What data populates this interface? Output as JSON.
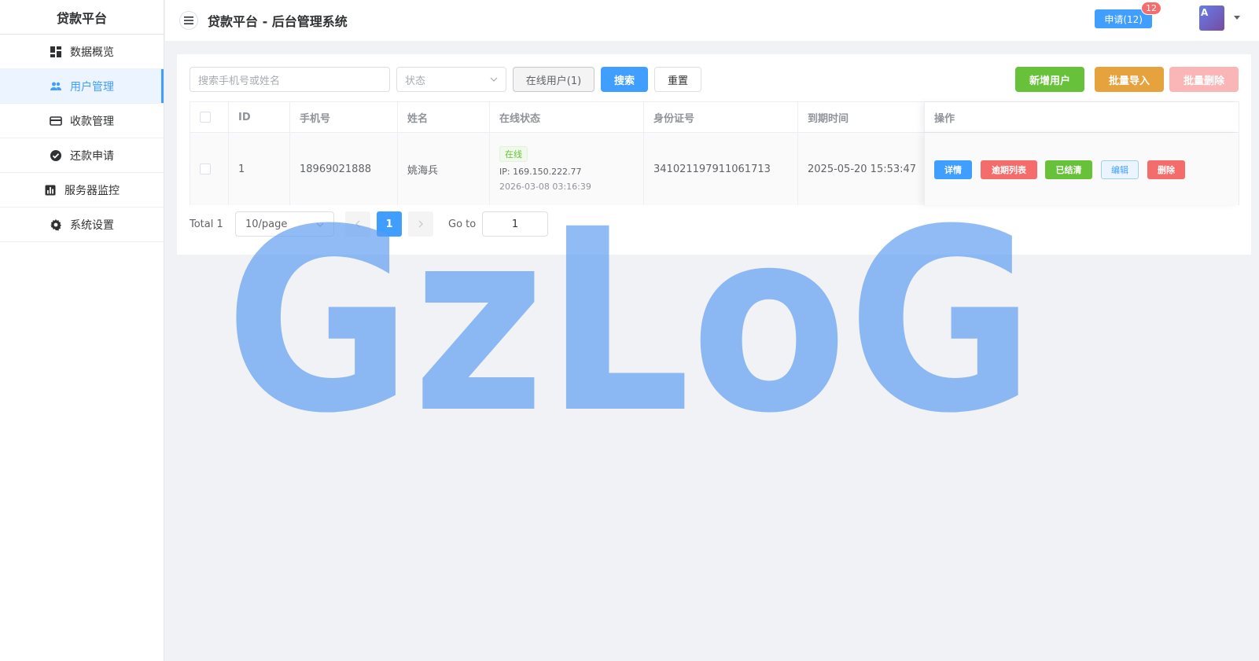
{
  "sidebar": {
    "brand": "贷款平台",
    "items": [
      {
        "label": "数据概览",
        "icon": "dashboard-icon"
      },
      {
        "label": "用户管理",
        "icon": "users-icon",
        "active": true
      },
      {
        "label": "收款管理",
        "icon": "credit-card-icon"
      },
      {
        "label": "还款申请",
        "icon": "check-circle-icon"
      },
      {
        "label": "服务器监控",
        "icon": "bar-chart-icon"
      },
      {
        "label": "系统设置",
        "icon": "gear-icon"
      }
    ]
  },
  "header": {
    "title": "贷款平台 - 后台管理系统",
    "apply_label": "申请(12)",
    "apply_badge": "12",
    "avatar_letter": "A"
  },
  "toolbar": {
    "search_placeholder": "搜索手机号或姓名",
    "status_placeholder": "状态",
    "online_users_label": "在线用户(1)",
    "search_label": "搜索",
    "reset_label": "重置",
    "add_user_label": "新增用户",
    "batch_import_label": "批量导入",
    "batch_delete_label": "批量删除"
  },
  "table": {
    "headers": {
      "id": "ID",
      "phone": "手机号",
      "name": "姓名",
      "online_status": "在线状态",
      "id_card": "身份证号",
      "expire_time": "到期时间",
      "actions": "操作"
    },
    "rows": [
      {
        "id": "1",
        "phone": "18969021888",
        "name": "姚海兵",
        "status_tag": "在线",
        "ip": "IP: 169.150.222.77",
        "last_time": "2026-03-08 03:16:39",
        "id_card": "341021197911061713",
        "expire_time": "2025-05-20 15:53:47",
        "actions": {
          "detail": "详情",
          "overdue_list": "逾期列表",
          "settled": "已结清",
          "edit": "编辑",
          "delete": "删除"
        }
      }
    ]
  },
  "pagination": {
    "total": "Total 1",
    "page_size": "10/page",
    "current_page": "1",
    "goto_label": "Go to",
    "goto_value": "1"
  },
  "watermark": {
    "text": "GzLoG",
    "color": "#5b9bf0"
  },
  "colors": {
    "primary": "#409eff",
    "success": "#67c23a",
    "warning": "#e6a23c",
    "danger": "#f56c6c"
  }
}
